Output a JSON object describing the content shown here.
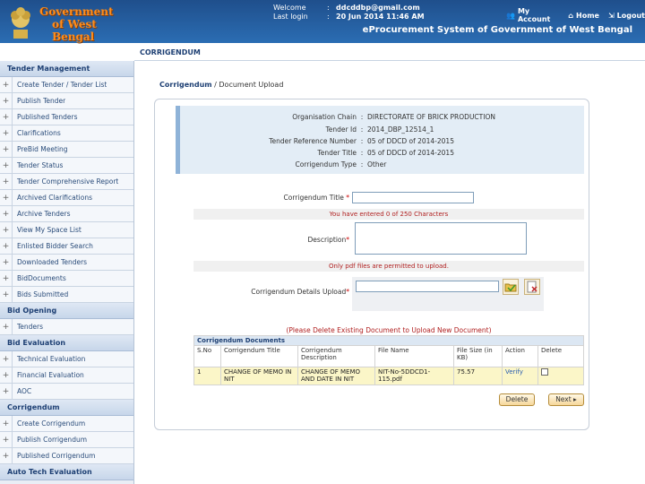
{
  "header": {
    "logo_line1": "Government",
    "logo_line2": "of West Bengal",
    "welcome_label": "Welcome",
    "welcome_value": "ddcddbp@gmail.com",
    "last_login_label": "Last login",
    "last_login_value": "20 Jun 2014 11:46 AM",
    "my_account": "My Account",
    "home": "Home",
    "logout": "Logout",
    "system_title": "eProcurement System of Government of West Bengal",
    "colors": {
      "background": "#2b6db3",
      "logo": "#ff8c1a"
    }
  },
  "page_heading": "CORRIGENDUM",
  "breadcrumb": {
    "root": "Corrigendum",
    "separator": " / ",
    "current": "Document Upload"
  },
  "sidebar": {
    "sections": [
      {
        "title": "Tender Management",
        "items": [
          "Create Tender / Tender List",
          "Publish Tender",
          "Published Tenders",
          "Clarifications",
          "PreBid Meeting",
          "Tender Status",
          "Tender Comprehensive Report",
          "Archived Clarifications",
          "Archive Tenders",
          "View My Space List",
          "Enlisted Bidder Search",
          "Downloaded Tenders",
          "BidDocuments",
          "Bids Submitted"
        ]
      },
      {
        "title": "Bid Opening",
        "items": [
          "Tenders"
        ]
      },
      {
        "title": "Bid Evaluation",
        "items": [
          "Technical Evaluation",
          "Financial Evaluation",
          "AOC"
        ]
      },
      {
        "title": "Corrigendum",
        "items": [
          "Create Corrigendum",
          "Publish Corrigendum",
          "Published Corrigendum"
        ]
      },
      {
        "title": "Auto Tech Evaluation",
        "items": []
      }
    ]
  },
  "info": {
    "org_label": "Organisation Chain",
    "org_value": "DIRECTORATE OF BRICK PRODUCTION",
    "tender_id_label": "Tender Id",
    "tender_id_value": "2014_DBP_12514_1",
    "ref_label": "Tender Reference Number",
    "ref_value": "05 of DDCD of 2014-2015",
    "title_label": "Tender Title",
    "title_value": "05 of DDCD of 2014-2015",
    "type_label": "Corrigendum Type",
    "type_value": "Other",
    "separator": ":"
  },
  "form": {
    "title_label": "Corrigendum Title",
    "title_value": "",
    "chars_note": "You have entered 0 of 250 Characters",
    "desc_label": "Description",
    "desc_value": "",
    "pdf_note": "Only pdf files are permitted to upload.",
    "upload_label": "Corrigendum Details Upload",
    "upload_value": "",
    "required_mark": "*"
  },
  "docs": {
    "warning": "(Please Delete Existing Document to Upload New Document)",
    "caption": "Corrigendum Documents",
    "headers": [
      "S.No",
      "Corrigendum Title",
      "Corrigendum Description",
      "File Name",
      "File Size (in KB)",
      "Action",
      "Delete"
    ],
    "rows": [
      {
        "sno": "1",
        "title": "CHANGE OF MEMO IN NIT",
        "description": "CHANGE OF MEMO AND DATE IN NIT",
        "file": "NIT-No-5DDCD1-115.pdf",
        "size": "75.57",
        "action": "Verify"
      }
    ]
  },
  "buttons": {
    "delete": "Delete",
    "next": "Next ▸"
  }
}
